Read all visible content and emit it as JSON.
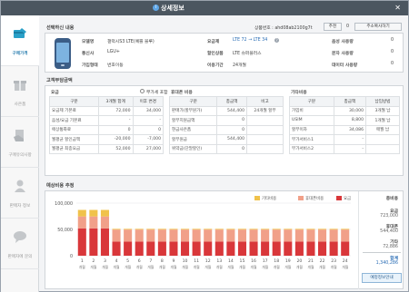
{
  "window": {
    "title": "상세정보",
    "close_glyph": "✕"
  },
  "sidebar": {
    "items": [
      {
        "label": "구매가격",
        "icon": "price-card-icon",
        "active": true
      },
      {
        "label": "사은품",
        "icon": "gift-icon",
        "active": false
      },
      {
        "label": "구매유의사항",
        "icon": "notice-hand-icon",
        "active": false
      },
      {
        "label": "판매자 정보",
        "icon": "seller-person-icon",
        "active": false
      },
      {
        "label": "판매자에 문의",
        "icon": "chat-bubble-icon",
        "active": false
      }
    ]
  },
  "product": {
    "section_title": "선택하신 내용",
    "code_label": "상품번호 : ahd08ab2100g7t",
    "share_label": "추천",
    "share_count": "0",
    "address_btn": "주소복사하기",
    "model_label": "모델명",
    "model_value": "갤럭시S3 LTE(예쁠 블루)",
    "carrier_label": "통신사",
    "carrier_value": "LGU+",
    "join_label": "가입형태",
    "join_value": "번호이동",
    "plan_label": "요금제",
    "plan_value": "LTE 72 → LTE 34",
    "discount_label": "할인상품",
    "discount_value": "LTE 슈퍼플러스",
    "period_label": "이용기간",
    "period_value": "24개월",
    "voice_label": "음성 사용량",
    "voice_value": "0",
    "sms_label": "문자 사용량",
    "sms_value": "0",
    "data_label": "데이터 사용량",
    "data_value": "0"
  },
  "burden": {
    "section_title": "고객부담금액",
    "fee": {
      "title": "요금",
      "vat_label": "부가세 포함",
      "headers": [
        "구분",
        "3개월 합계",
        "이후 변경"
      ],
      "rows": [
        [
          "요금제 기본료",
          "72,000",
          "34,000"
        ],
        [
          "음성/요금 기본료",
          "-",
          "-"
        ],
        [
          "애상통화료",
          "0",
          "0"
        ],
        [
          "월평균 할인금액",
          "-20,000",
          "-7,000"
        ],
        [
          "월평균 최종요금",
          "52,000",
          "27,000"
        ]
      ]
    },
    "phone": {
      "title": "휴대폰 비용",
      "headers": [
        "구분",
        "총금액",
        "비고"
      ],
      "rows": [
        [
          "판매가(할부원가)",
          "544,400",
          "24개월 할부"
        ],
        [
          "할부지원금액",
          "0",
          ""
        ],
        [
          "현금사은품",
          "0",
          ""
        ],
        [
          "할부원금",
          "544,400",
          ""
        ],
        [
          "위약금(단말할인)",
          "0",
          ""
        ]
      ]
    },
    "other": {
      "title": "기타비용",
      "headers": [
        "구분",
        "총금액",
        "납입방법"
      ],
      "rows": [
        [
          "가입비",
          "30,000",
          "3개월 납"
        ],
        [
          "USIM",
          "8,800",
          "1개월 납"
        ],
        [
          "할부이자",
          "34,086",
          "매월 납"
        ],
        [
          "부가서비스1",
          "-",
          ""
        ],
        [
          "부가서비스2",
          "-",
          ""
        ]
      ]
    }
  },
  "estimate": {
    "section_title": "예상비용 추정",
    "legend": [
      {
        "name": "기타비용",
        "color": "#f0c24b"
      },
      {
        "name": "휴대폰비용",
        "color": "#f1a089"
      },
      {
        "name": "요금",
        "color": "#d9373a"
      }
    ],
    "y_ticks": [
      "100,000",
      "50,000",
      "0"
    ],
    "x_month_label": "개월",
    "summary": {
      "title": "총비용",
      "items": [
        {
          "label": "요금",
          "value": "723,000"
        },
        {
          "label": "휴대폰",
          "value": "544,400"
        },
        {
          "label": "기타",
          "value": "72,886"
        },
        {
          "label": "합계",
          "value": "1,340,286"
        }
      ],
      "button": "예정정보안내"
    }
  },
  "chart_data": {
    "type": "bar",
    "stacked": true,
    "categories": [
      "1",
      "2",
      "3",
      "4",
      "5",
      "6",
      "7",
      "8",
      "9",
      "10",
      "11",
      "12",
      "13",
      "14",
      "15",
      "16",
      "17",
      "18",
      "19",
      "20",
      "21",
      "22",
      "23",
      "24"
    ],
    "series": [
      {
        "name": "요금",
        "color": "#d9373a",
        "values": [
          52000,
          52000,
          52000,
          27000,
          27000,
          27000,
          27000,
          27000,
          27000,
          27000,
          27000,
          27000,
          27000,
          27000,
          27000,
          27000,
          27000,
          27000,
          27000,
          27000,
          27000,
          27000,
          27000,
          27000
        ]
      },
      {
        "name": "휴대폰비용",
        "color": "#f1a089",
        "values": [
          22700,
          22700,
          22700,
          22700,
          22700,
          22700,
          22700,
          22700,
          22700,
          22700,
          22700,
          22700,
          22700,
          22700,
          22700,
          22700,
          22700,
          22700,
          22700,
          22700,
          22700,
          22700,
          22700,
          22700
        ]
      },
      {
        "name": "기타비용",
        "color": "#f0c24b",
        "values": [
          12400,
          12400,
          12400,
          1400,
          1400,
          1400,
          1400,
          1400,
          1400,
          1400,
          1400,
          1400,
          1400,
          1400,
          1400,
          1400,
          1400,
          1400,
          1400,
          1400,
          1400,
          1400,
          1400,
          1400
        ]
      }
    ],
    "ylim": [
      0,
      100000
    ],
    "yticks": [
      0,
      50000,
      100000
    ],
    "grid": true,
    "legend": "top-right"
  }
}
